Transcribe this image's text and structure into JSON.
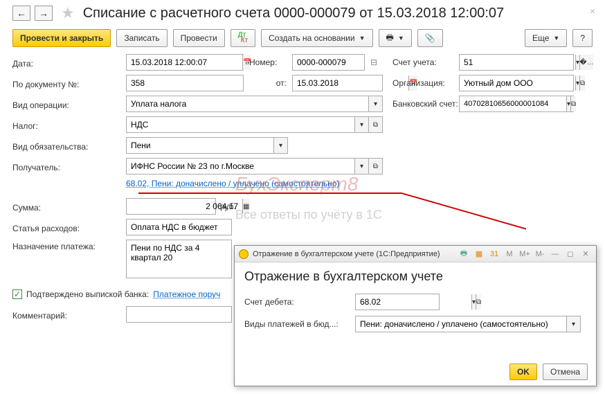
{
  "header": {
    "title": "Списание с расчетного счета 0000-000079 от 15.03.2018 12:00:07"
  },
  "toolbar": {
    "post_close": "Провести и закрыть",
    "save": "Записать",
    "post": "Провести",
    "create_based": "Создать на основании",
    "more": "Еще",
    "help": "?"
  },
  "form": {
    "date_lbl": "Дата:",
    "date": "15.03.2018 12:00:07",
    "number_lbl": "Номер:",
    "number": "0000-000079",
    "account_lbl": "Счет учета:",
    "account": "51",
    "doc_no_lbl": "По документу №:",
    "doc_no": "358",
    "doc_from_lbl": "от:",
    "doc_from": "15.03.2018",
    "org_lbl": "Организация:",
    "org": "Уютный дом ООО",
    "op_type_lbl": "Вид операции:",
    "op_type": "Уплата налога",
    "bank_acc_lbl": "Банковский счет:",
    "bank_acc": "40702810656000001084",
    "tax_lbl": "Налог:",
    "tax": "НДС",
    "liab_lbl": "Вид обязательства:",
    "liab": "Пени",
    "recipient_lbl": "Получатель:",
    "recipient": "ИФНС России № 23 по г.Москве",
    "link": "68.02, Пени: доначислено / уплачено (самостоятельно)",
    "sum_lbl": "Сумма:",
    "sum": "2 064,17",
    "rub": "руб.",
    "expense_lbl": "Статья расходов:",
    "expense": "Оплата НДС в бюджет",
    "purpose_lbl": "Назначение платежа:",
    "purpose": "Пени по НДС за 4 квартал 20",
    "confirmed": "Подтверждено выпиской банка:",
    "payorder_link": "Платежное поруч",
    "comment_lbl": "Комментарий:"
  },
  "dialog": {
    "titlebar": "Отражение в бухгалтерском учете  (1С:Предприятие)",
    "title": "Отражение в бухгалтерском учете",
    "debit_lbl": "Счет дебета:",
    "debit": "68.02",
    "paytype_lbl": "Виды платежей в бюд...:",
    "paytype": "Пени: доначислено / уплачено (самостоятельно)",
    "ok": "OK",
    "cancel": "Отмена",
    "tools": {
      "m": "M",
      "mplus": "M+",
      "mminus": "M-"
    }
  },
  "watermark": {
    "t1": "БухЭксперт8",
    "t2": "Все ответы по учёту в 1С"
  }
}
